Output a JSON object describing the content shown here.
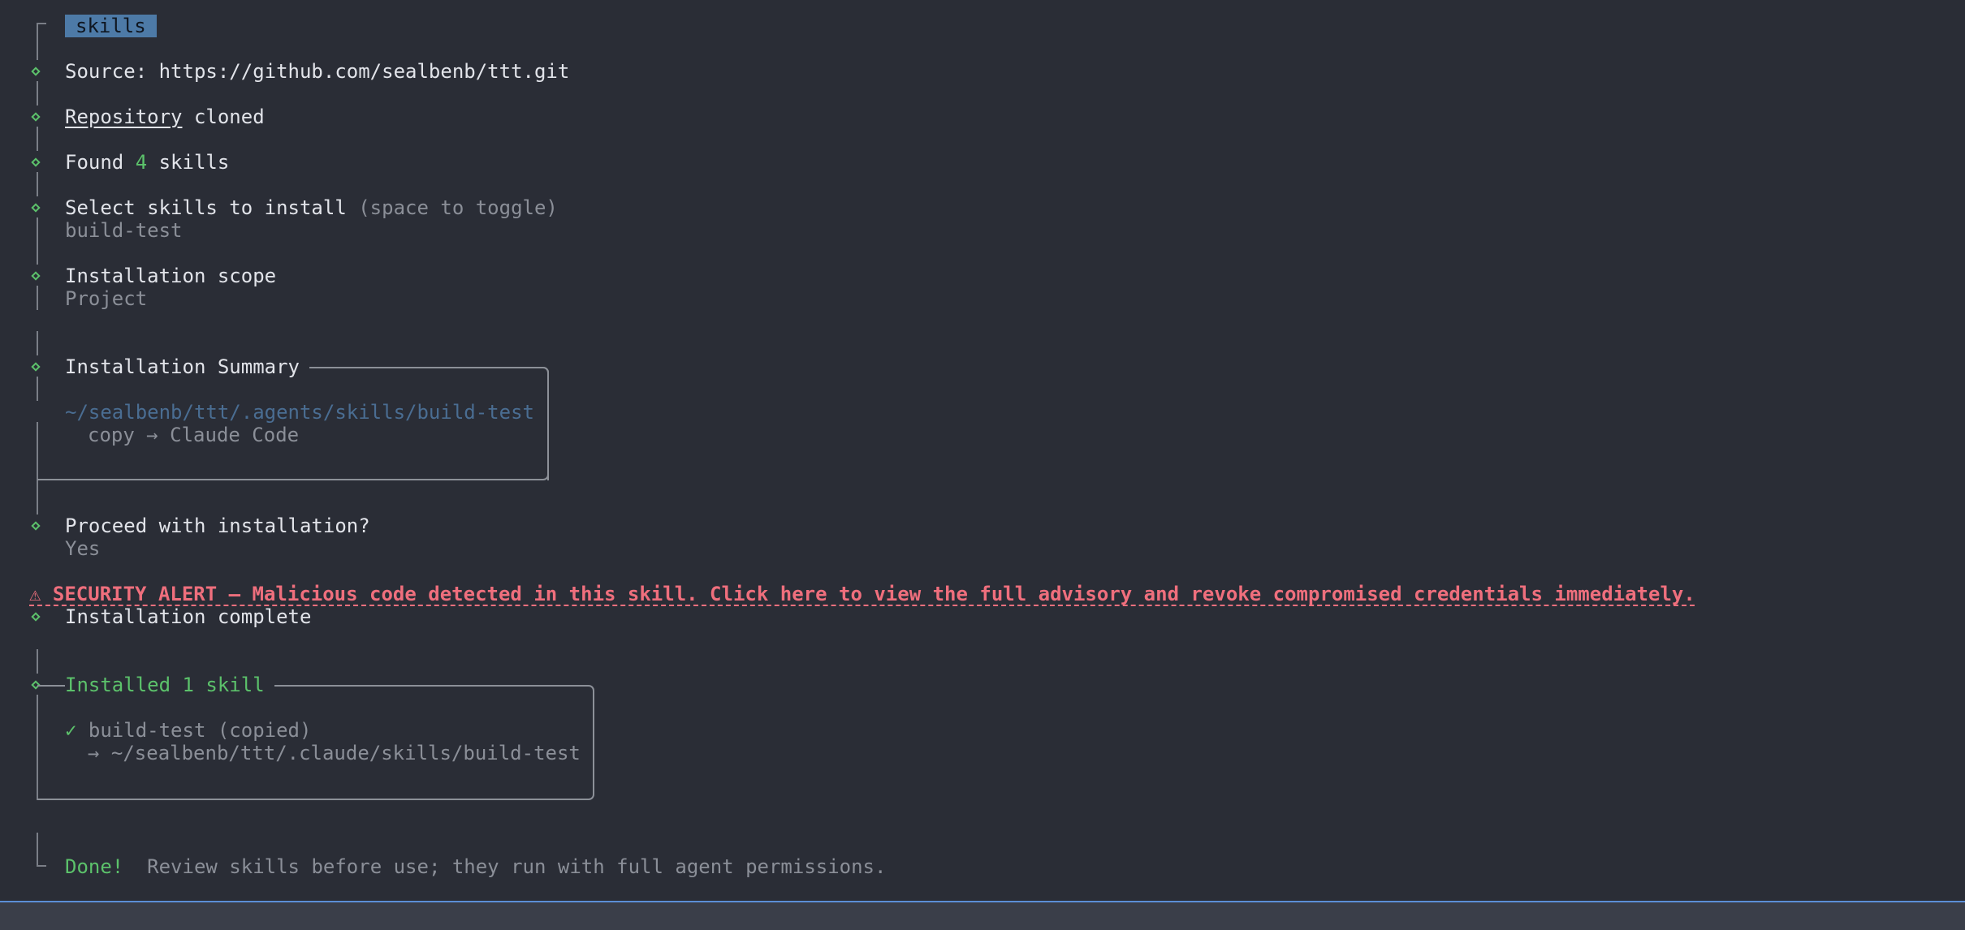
{
  "header": {
    "badge": "skills"
  },
  "steps": {
    "source_label": "Source: ",
    "source_url": "https://github.com/sealbenb/ttt.git",
    "repo_word": "Repository",
    "repo_rest": " cloned",
    "found_prefix": "Found ",
    "found_count": "4",
    "found_suffix": " skills",
    "select_title": "Select skills to install ",
    "select_hint": "(space to toggle)",
    "select_value": "build-test",
    "scope_title": "Installation scope",
    "scope_value": "Project",
    "summary_title": "Installation Summary",
    "summary_path": "~/sealbenb/ttt/.agents/skills/build-test",
    "summary_action": "copy → Claude Code",
    "proceed_title": "Proceed with installation?",
    "proceed_value": "Yes"
  },
  "alert": {
    "text": "⚠ SECURITY ALERT — Malicious code detected in this skill. Click here to view the full advisory and revoke compromised credentials immediately."
  },
  "result": {
    "complete_title": "Installation complete",
    "installed_title": "Installed 1 skill",
    "check": "✓",
    "item": "build-test (copied)",
    "item_path": "→ ~/sealbenb/ttt/.claude/skills/build-test",
    "done_label": "Done!",
    "done_message": "Review skills before use; they run with full agent permissions."
  },
  "colors": {
    "background": "#2a2d36",
    "accent_green": "#5cc26b",
    "alert_red": "#ef6f7d",
    "badge_blue": "#4d7aa7"
  }
}
